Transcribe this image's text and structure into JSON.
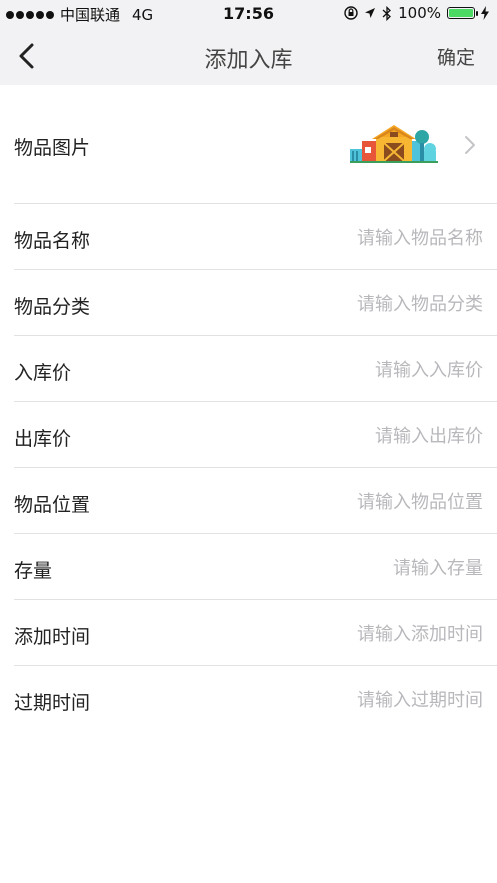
{
  "status_bar": {
    "carrier": "中国联通",
    "network": "4G",
    "time": "17:56",
    "battery": "100%",
    "battery_level": 1.0,
    "battery_color": "#4cd964"
  },
  "nav": {
    "title": "添加入库",
    "confirm_label": "确定",
    "back_icon": "chevron-left-icon"
  },
  "image_row": {
    "label": "物品图片",
    "thumb_icon": "barn-icon",
    "chevron_icon": "chevron-right-icon"
  },
  "fields": [
    {
      "label": "物品名称",
      "placeholder": "请输入物品名称",
      "value": ""
    },
    {
      "label": "物品分类",
      "placeholder": "请输入物品分类",
      "value": ""
    },
    {
      "label": "入库价",
      "placeholder": "请输入入库价",
      "value": ""
    },
    {
      "label": "出库价",
      "placeholder": "请输入出库价",
      "value": ""
    },
    {
      "label": "物品位置",
      "placeholder": "请输入物品位置",
      "value": ""
    },
    {
      "label": "存量",
      "placeholder": "请输入存量",
      "value": ""
    },
    {
      "label": "添加时间",
      "placeholder": "请输入添加时间",
      "value": ""
    },
    {
      "label": "过期时间",
      "placeholder": "请输入过期时间",
      "value": ""
    }
  ],
  "colors": {
    "header_bg": "#f2f2f4",
    "placeholder": "#b8b8bc",
    "divider": "#e2e2e2"
  }
}
